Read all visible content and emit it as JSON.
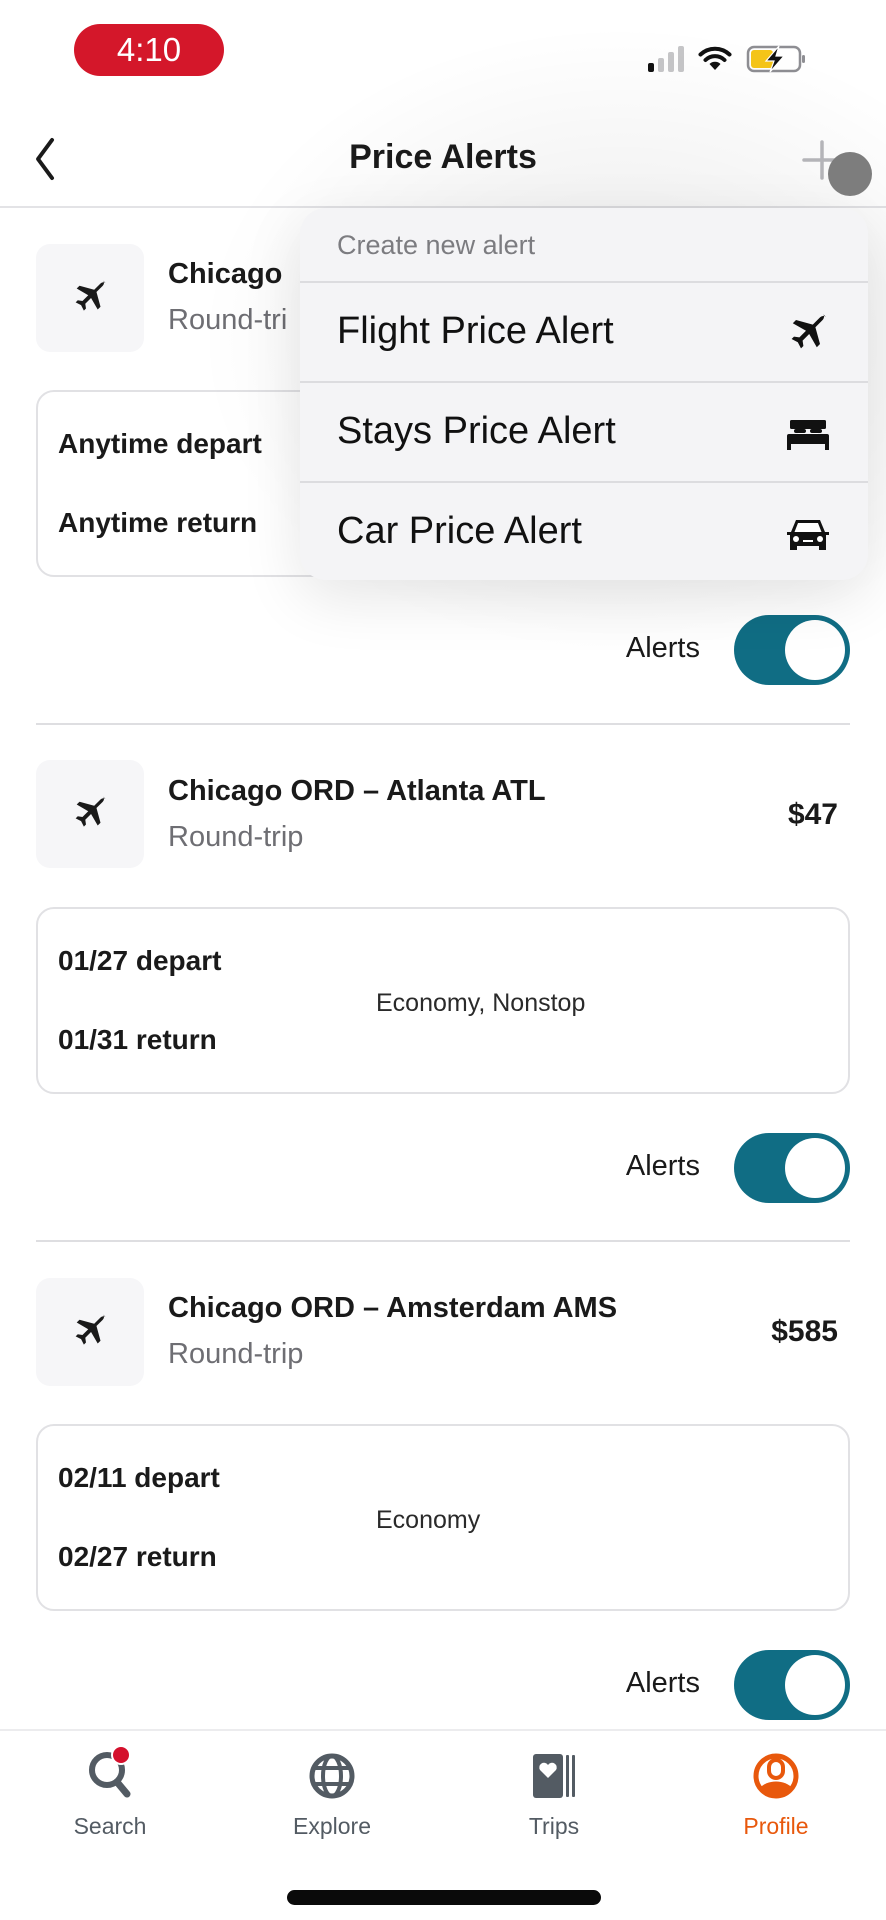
{
  "status_bar": {
    "time": "4:10",
    "signal_icon": "cellular-signal-icon",
    "wifi_icon": "wifi-icon",
    "battery_icon": "battery-charging-icon",
    "time_pill_color": "#d4172a",
    "battery_fill_color": "#f5c518"
  },
  "header": {
    "title": "Price Alerts",
    "back_icon": "chevron-left-icon",
    "add_icon": "plus-icon"
  },
  "dropdown": {
    "header": "Create new alert",
    "items": [
      {
        "label": "Flight Price Alert",
        "icon": "airplane-icon"
      },
      {
        "label": "Stays Price Alert",
        "icon": "bed-icon"
      },
      {
        "label": "Car Price Alert",
        "icon": "car-icon"
      }
    ]
  },
  "alerts": [
    {
      "route": "Chicago",
      "trip_type": "Round-tri",
      "price": "",
      "depart": "Anytime depart",
      "return": "Anytime return",
      "cabin": "",
      "alerts_label": "Alerts",
      "alerts_on": true
    },
    {
      "route": "Chicago ORD – Atlanta ATL",
      "trip_type": "Round-trip",
      "price": "$47",
      "depart": "01/27 depart",
      "return": "01/31 return",
      "cabin": "Economy, Nonstop",
      "alerts_label": "Alerts",
      "alerts_on": true
    },
    {
      "route": "Chicago ORD – Amsterdam AMS",
      "trip_type": "Round-trip",
      "price": "$585",
      "depart": "02/11 depart",
      "return": "02/27 return",
      "cabin": "Economy",
      "alerts_label": "Alerts",
      "alerts_on": true
    }
  ],
  "toggle_color": "#106d84",
  "bottom_nav": {
    "items": [
      {
        "label": "Search",
        "icon": "search-icon",
        "active": false,
        "badge": true
      },
      {
        "label": "Explore",
        "icon": "globe-icon",
        "active": false
      },
      {
        "label": "Trips",
        "icon": "trips-icon",
        "active": false
      },
      {
        "label": "Profile",
        "icon": "profile-icon",
        "active": true
      }
    ],
    "active_color": "#e8580c",
    "inactive_color": "#535b63",
    "badge_color": "#d4102c"
  }
}
